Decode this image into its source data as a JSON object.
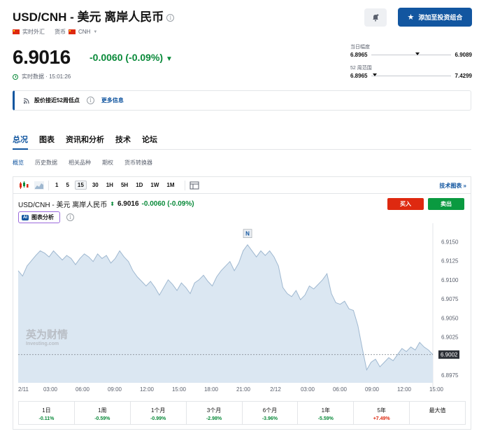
{
  "header": {
    "title": "USD/CNH - 美元 离岸人民币",
    "market_type": "实时外汇",
    "currency_label": "货币",
    "currency_code": "CNH",
    "add_button_label": "添加至投资组合"
  },
  "quote": {
    "price": "6.9016",
    "change": "-0.0060 (-0.09%)",
    "data_status": "实时数据 · 15:01:26"
  },
  "ranges": {
    "day_label": "当日幅度",
    "day_low": "6.8965",
    "day_high": "6.9089",
    "week52_label": "52 周范围",
    "week52_low": "6.8965",
    "week52_high": "7.4299"
  },
  "alert": {
    "text": "股价接近52周低点",
    "more": "更多信息"
  },
  "tabs": [
    "总况",
    "图表",
    "资讯和分析",
    "技术",
    "论坛"
  ],
  "subtabs": [
    "概览",
    "历史数据",
    "相关品种",
    "期权",
    "货币转换器"
  ],
  "toolbar": {
    "intervals": [
      "1",
      "5",
      "15",
      "30",
      "1H",
      "5H",
      "1D",
      "1W",
      "1M"
    ],
    "active_interval": "15",
    "tech_chart_link": "技术图表 »"
  },
  "chart_header": {
    "name": "USD/CNH - 美元 离岸人民币",
    "price": "6.9016",
    "change": "-0.0060 (-0.09%)",
    "sell_label": "买入",
    "buy_label": "卖出",
    "ai_tag": "AI",
    "ai_label": "图表分析"
  },
  "watermark": {
    "brand": "英为财情",
    "domain": "Investing.com"
  },
  "chart_data": {
    "type": "area",
    "ylim": [
      6.8965,
      6.9165
    ],
    "yticks": [
      "6.9150",
      "6.9125",
      "6.9100",
      "6.9075",
      "6.9050",
      "6.9025",
      "6.9000",
      "6.8975"
    ],
    "current_value_label": "6.9002",
    "marker_label": "N",
    "xticks": [
      "2/11",
      "03:00",
      "06:00",
      "09:00",
      "12:00",
      "15:00",
      "18:00",
      "21:00",
      "2/12",
      "03:00",
      "06:00",
      "09:00",
      "12:00",
      "15:00"
    ],
    "y": [
      6.9112,
      6.9105,
      6.9118,
      6.9125,
      6.9132,
      6.9138,
      6.9135,
      6.913,
      6.9138,
      6.9132,
      6.9126,
      6.9132,
      6.9128,
      6.912,
      6.9128,
      6.9134,
      6.913,
      6.9124,
      6.9134,
      6.9128,
      6.9132,
      6.9122,
      6.9128,
      6.9138,
      6.913,
      6.9124,
      6.9112,
      6.9104,
      6.9098,
      6.9092,
      6.9098,
      6.909,
      6.908,
      6.909,
      6.91,
      6.9094,
      6.9086,
      6.9096,
      6.909,
      6.9082,
      6.9096,
      6.91,
      6.9106,
      6.9098,
      6.9092,
      6.9104,
      6.9112,
      6.9118,
      6.9124,
      6.9112,
      6.9122,
      6.9138,
      6.9146,
      6.9138,
      6.913,
      6.9138,
      6.9132,
      6.9138,
      6.913,
      6.9118,
      6.909,
      6.9082,
      6.9078,
      6.9086,
      6.9074,
      6.908,
      6.9092,
      6.9088,
      6.9094,
      6.91,
      6.9108,
      6.9082,
      6.907,
      6.9068,
      6.9072,
      6.9062,
      6.906,
      6.904,
      6.901,
      6.8982,
      6.8992,
      6.8996,
      6.8986,
      6.8992,
      6.8998,
      6.8994,
      6.9002,
      6.901,
      6.9006,
      6.9012,
      6.9008,
      6.9018,
      6.9012,
      6.9008,
      6.9002
    ]
  },
  "performance": [
    {
      "label": "1日",
      "value": "-0.11%",
      "dir": "neg"
    },
    {
      "label": "1周",
      "value": "-0.59%",
      "dir": "neg"
    },
    {
      "label": "1个月",
      "value": "-0.99%",
      "dir": "neg"
    },
    {
      "label": "3个月",
      "value": "-2.98%",
      "dir": "neg"
    },
    {
      "label": "6个月",
      "value": "-3.96%",
      "dir": "neg"
    },
    {
      "label": "1年",
      "value": "-5.59%",
      "dir": "neg"
    },
    {
      "label": "5年",
      "value": "+7.49%",
      "dir": "pos"
    },
    {
      "label": "最大值",
      "value": "",
      "dir": "pos"
    }
  ],
  "colors": {
    "accent": "#1256a0",
    "positive_green": "#0a8a3a",
    "negative_red": "#de2910",
    "area_fill": "#dbe7f2",
    "area_line": "#9fb8d0"
  }
}
